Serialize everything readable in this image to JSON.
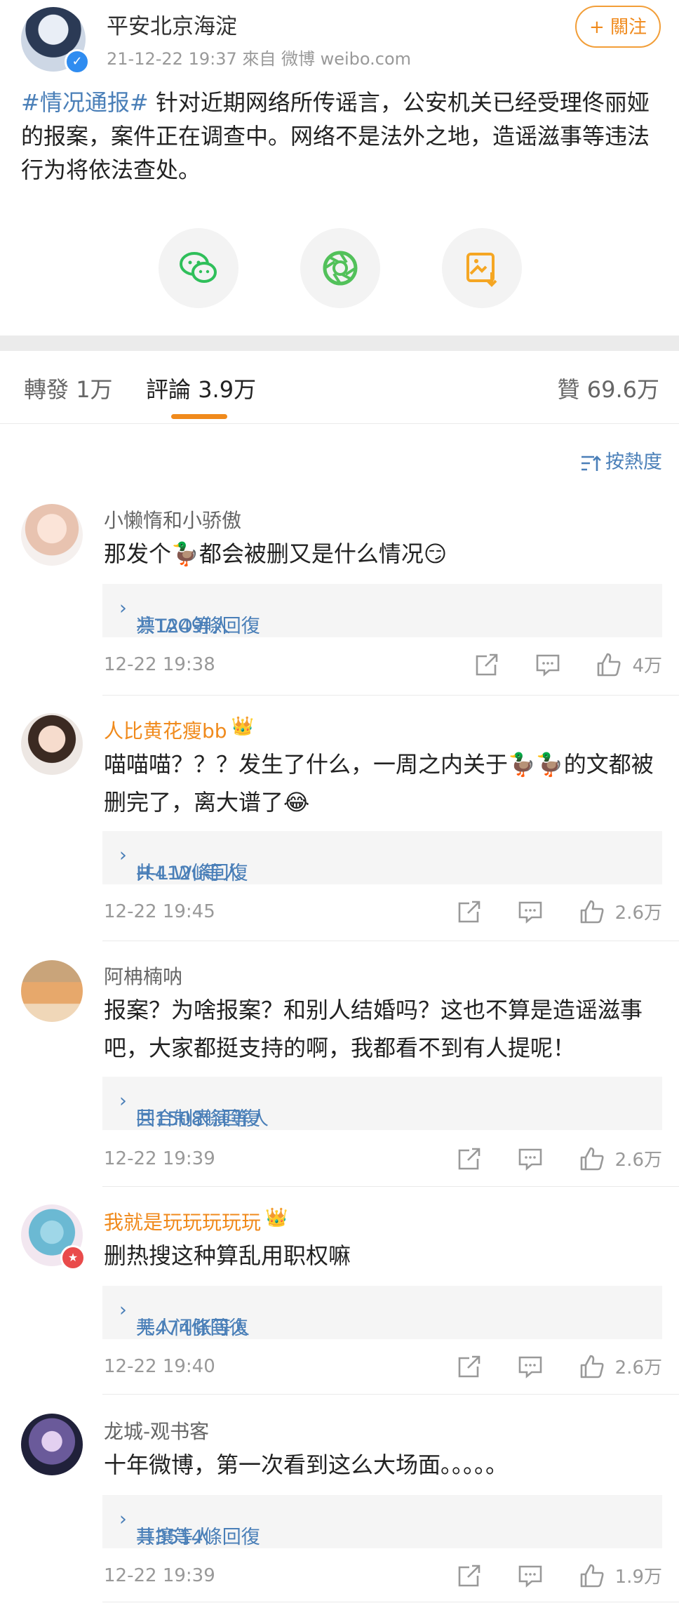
{
  "post": {
    "author": "平安北京海淀",
    "meta": "21-12-22 19:37  來自 微博 weibo.com",
    "follow_label": "+ 關注",
    "hashtag": "#情况通报#",
    "body": "针对近期网络所传谣言，公安机关已经受理佟丽娅的报案，案件正在调查中。网络不是法外之地，造谣滋事等违法行为将依法查处。",
    "share_icons": [
      "wechat-icon",
      "moments-icon",
      "save-image-icon"
    ],
    "icon_colors": {
      "wechat": "#2fbf5a",
      "moments": "#52c15a",
      "save": "#f5a623"
    }
  },
  "tabs": {
    "repost_label": "轉發",
    "repost_count": "1万",
    "comment_label": "評論",
    "comment_count": "3.9万",
    "like_label": "贊",
    "like_count": "69.6万"
  },
  "sort_label": "按熱度",
  "comments": [
    {
      "name": "小懒惰和小骄傲",
      "vip": false,
      "text": "那发个🦆都会被删又是什么情况😏",
      "reply_users": "凛TAO等人",
      "reply_total": "共1249條回復",
      "time": "12-22 19:38",
      "likes": "4万"
    },
    {
      "name": "人比黄花瘦bb",
      "vip": true,
      "text": "喵喵喵？？？发生了什么，一周之内关于🦆🦆的文都被删完了，离大谱了😂",
      "reply_users": "H-L-Wu等人",
      "reply_total": "共412條回復",
      "time": "12-22 19:45",
      "likes": "2.6万"
    },
    {
      "name": "阿柟楠呐",
      "vip": false,
      "text": "报案？为啥报案？和别人结婚吗？这也不算是造谣滋事吧，大家都挺支持的啊，我都看不到有人提呢！",
      "reply_users": "回合制表演等人",
      "reply_total": "共1508條回復",
      "time": "12-22 19:39",
      "likes": "2.6万"
    },
    {
      "name": "我就是玩玩玩玩玩",
      "vip": true,
      "text": "删热搜这种算乱用职权嘛",
      "reply_users": "无人问张等人",
      "reply_total": "共474條回復",
      "time": "12-22 19:40",
      "likes": "2.6万"
    },
    {
      "name": "龙城-观书客",
      "vip": false,
      "text": "十年微博，第一次看到这么大场面。。。。。",
      "reply_users": "荨攘等人",
      "reply_total": "共3514條回復",
      "time": "12-22 19:39",
      "likes": "1.9万"
    }
  ]
}
